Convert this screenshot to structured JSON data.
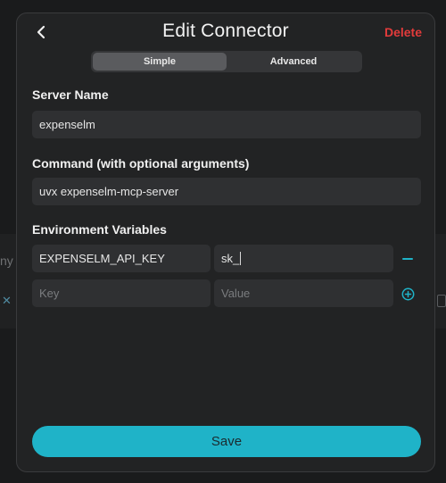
{
  "background": {
    "partial_text": "ny"
  },
  "modal": {
    "title": "Edit Connector",
    "delete_label": "Delete",
    "tabs": [
      {
        "label": "Simple",
        "active": true
      },
      {
        "label": "Advanced",
        "active": false
      }
    ],
    "server_name": {
      "label": "Server Name",
      "value": "expenselm"
    },
    "command": {
      "label": "Command (with optional arguments)",
      "value": "uvx expenselm-mcp-server"
    },
    "env": {
      "label": "Environment Variables",
      "rows": [
        {
          "key": "EXPENSELM_API_KEY",
          "value": "sk_"
        }
      ],
      "key_placeholder": "Key",
      "value_placeholder": "Value"
    },
    "save_label": "Save"
  },
  "colors": {
    "accent": "#1fb3c8",
    "danger": "#e23b3b",
    "modal_bg": "#222324",
    "field_bg": "#2f3032"
  },
  "icons": {
    "back": "chevron-left-icon",
    "remove": "minus-icon",
    "add": "plus-circle-icon"
  }
}
